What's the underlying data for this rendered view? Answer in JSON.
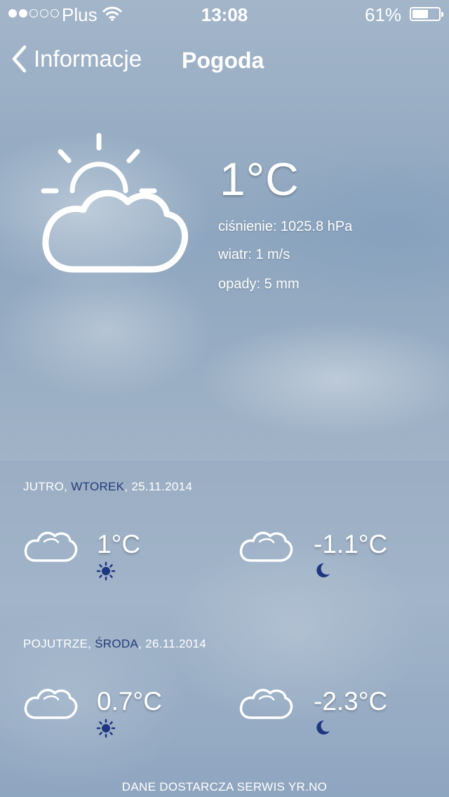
{
  "status_bar": {
    "carrier": "Plus",
    "time": "13:08",
    "battery_percent": "61%",
    "battery_level": 0.61,
    "signal_bars_filled": 2,
    "signal_bars_total": 5
  },
  "nav": {
    "back_label": "Informacje",
    "title": "Pogoda"
  },
  "current": {
    "icon": "partly-cloudy-icon",
    "temperature": "1°C",
    "pressure": "ciśnienie: 1025.8 hPa",
    "wind": "wiatr: 1 m/s",
    "precipitation": "opady: 5 mm"
  },
  "forecast": [
    {
      "day_prefix": "JUTRO, ",
      "weekday": "WTOREK",
      "date": ", 25.11.2014",
      "day_temp": "1°C",
      "night_temp": "-1.1°C",
      "day_icon": "cloud-icon",
      "night_icon": "cloud-icon",
      "day_small_icon": "sun-icon",
      "night_small_icon": "moon-icon"
    },
    {
      "day_prefix": "POJUTRZE, ",
      "weekday": "ŚRODA",
      "date": ", 26.11.2014",
      "day_temp": "0.7°C",
      "night_temp": "-2.3°C",
      "day_icon": "cloud-icon",
      "night_icon": "cloud-icon",
      "day_small_icon": "sun-icon",
      "night_small_icon": "moon-icon"
    }
  ],
  "footer": "DANE DOSTARCZA SERWIS YR.NO",
  "colors": {
    "weekday_text": "#233c7a",
    "small_icon": "#1e3580"
  }
}
